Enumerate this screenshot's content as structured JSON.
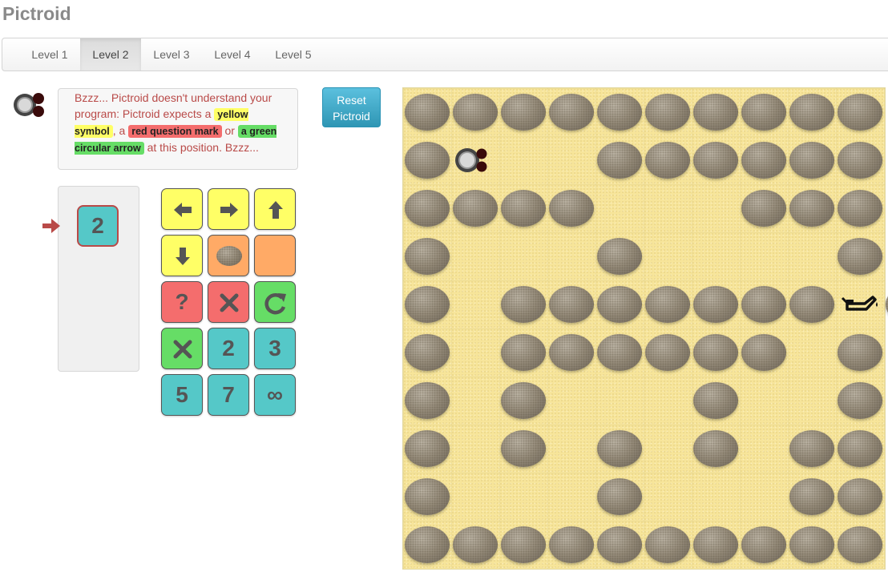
{
  "app": {
    "title": "Pictroid"
  },
  "tabs": [
    {
      "label": "Level 1",
      "active": false
    },
    {
      "label": "Level 2",
      "active": true
    },
    {
      "label": "Level 3",
      "active": false
    },
    {
      "label": "Level 4",
      "active": false
    },
    {
      "label": "Level 5",
      "active": false
    }
  ],
  "message": {
    "line_start": "Bzzz... Pictroid doesn't understand your program: Pictroid expects a ",
    "yellow_symbol": "yellow symbol",
    "sep1": ", a ",
    "red_question_mark": "red question mark",
    "sep2": " or ",
    "green_circular_arrow": "a green circular arrow",
    "line_end": " at this position. Bzzz..."
  },
  "reset_button": {
    "line1": "Reset",
    "line2": "Pictroid"
  },
  "program": {
    "slot_value": "2",
    "slot_color": "cyan"
  },
  "palette": [
    {
      "name": "move-left-tile",
      "color": "yellow",
      "icon": "arrow-left-icon"
    },
    {
      "name": "move-right-tile",
      "color": "yellow",
      "icon": "arrow-right-icon"
    },
    {
      "name": "move-up-tile",
      "color": "yellow",
      "icon": "arrow-up-icon"
    },
    {
      "name": "move-down-tile",
      "color": "yellow",
      "icon": "arrow-down-icon"
    },
    {
      "name": "rock-condition-tile",
      "color": "orange",
      "icon": "rock-icon"
    },
    {
      "name": "empty-condition-tile",
      "color": "orange",
      "icon": ""
    },
    {
      "name": "question-mark-tile",
      "color": "red",
      "label": "?"
    },
    {
      "name": "red-cross-tile",
      "color": "red",
      "icon": "cross-icon"
    },
    {
      "name": "circular-arrow-tile",
      "color": "green",
      "icon": "circular-arrow-icon"
    },
    {
      "name": "green-cross-tile",
      "color": "green",
      "icon": "cross-icon"
    },
    {
      "name": "repeat-2-tile",
      "color": "cyan",
      "label": "2"
    },
    {
      "name": "repeat-3-tile",
      "color": "cyan",
      "label": "3"
    },
    {
      "name": "repeat-5-tile",
      "color": "cyan",
      "label": "5"
    },
    {
      "name": "repeat-7-tile",
      "color": "cyan",
      "label": "7"
    },
    {
      "name": "repeat-infinity-tile",
      "color": "cyan",
      "label": "∞"
    }
  ],
  "colors": {
    "yellow": "#ffff66",
    "orange": "#ffaa66",
    "red": "#f46d6d",
    "green": "#66dd66",
    "cyan": "#55c8c8",
    "error_text": "#b94a48",
    "sand": "#f7e59a"
  },
  "board": {
    "rows": 10,
    "cols": 10,
    "legend": {
      "#": "rock",
      ".": "sand",
      "R": "robot",
      "O": "oil-can"
    },
    "grid": [
      "##########",
      "#R..######",
      "####...###",
      "#...#....#",
      "#.#######O#",
      "#.######.#",
      "#.#...#..#",
      "#.#.#.#.##",
      "#...#...##",
      "##########"
    ]
  }
}
